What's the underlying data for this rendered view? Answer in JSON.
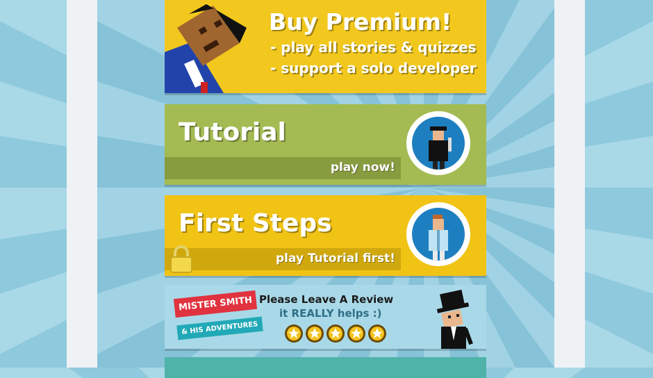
{
  "premium": {
    "title": "Buy Premium!",
    "line1": "- play all stories & quizzes",
    "line2": "- support a solo developer"
  },
  "tutorial": {
    "title": "Tutorial",
    "action": "play now!"
  },
  "first_steps": {
    "title": "First Steps",
    "action": "play Tutorial first!"
  },
  "review": {
    "badge_line1": "MISTER SMITH",
    "badge_line2": "& HIS ADVENTURES",
    "heading": "Please Leave A Review",
    "subheading": "it REALLY helps :)",
    "stars": 5
  },
  "colors": {
    "premium_yellow": "#f2c81e",
    "tutorial_green": "#a3bb52",
    "first_steps_yellow": "#f0c315",
    "review_blue": "#a9d9e8"
  }
}
